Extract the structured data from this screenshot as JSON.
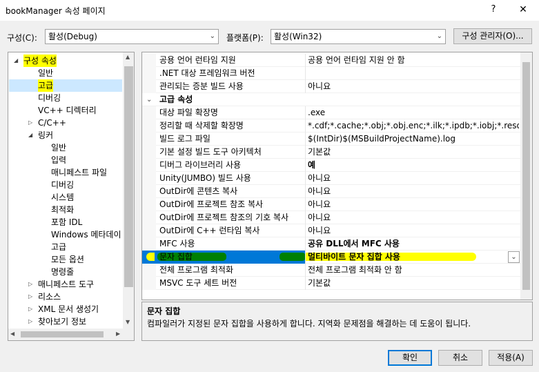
{
  "window": {
    "title": "bookManager 속성 페이지",
    "help": "?",
    "close": "✕"
  },
  "toolbar": {
    "config_label": "구성(C):",
    "config_value": "활성(Debug)",
    "platform_label": "플랫폼(P):",
    "platform_value": "활성(Win32)",
    "config_manager_label": "구성 관리자(O)..."
  },
  "tree": {
    "items": [
      {
        "label": "구성 속성",
        "level": 0,
        "arrow": "◢",
        "highlight": true
      },
      {
        "label": "일반",
        "level": 1
      },
      {
        "label": "고급",
        "level": 1,
        "selected": true,
        "highlight": true
      },
      {
        "label": "디버깅",
        "level": 1
      },
      {
        "label": "VC++ 디렉터리",
        "level": 1
      },
      {
        "label": "C/C++",
        "level": 1,
        "arrow": "▷"
      },
      {
        "label": "링커",
        "level": 1,
        "arrow": "◢"
      },
      {
        "label": "일반",
        "level": 2
      },
      {
        "label": "입력",
        "level": 2
      },
      {
        "label": "매니페스트 파일",
        "level": 2
      },
      {
        "label": "디버깅",
        "level": 2
      },
      {
        "label": "시스템",
        "level": 2
      },
      {
        "label": "최적화",
        "level": 2
      },
      {
        "label": "포함 IDL",
        "level": 2
      },
      {
        "label": "Windows 메타데이",
        "level": 2
      },
      {
        "label": "고급",
        "level": 2
      },
      {
        "label": "모든 옵션",
        "level": 2
      },
      {
        "label": "명령줄",
        "level": 2
      },
      {
        "label": "매니페스트 도구",
        "level": 1,
        "arrow": "▷"
      },
      {
        "label": "리소스",
        "level": 1,
        "arrow": "▷"
      },
      {
        "label": "XML 문서 생성기",
        "level": 1,
        "arrow": "▷"
      },
      {
        "label": "찾아보기 정보",
        "level": 1,
        "arrow": "▷"
      }
    ]
  },
  "grid": {
    "rows": [
      {
        "name": "공용 언어 런타임 지원",
        "value": "공용 언어 런타임 지원 안 함"
      },
      {
        "name": ".NET 대상 프레임워크 버전",
        "value": ""
      },
      {
        "name": "관리되는 증분 빌드 사용",
        "value": "아니요"
      },
      {
        "category": true,
        "name": "고급 속성",
        "arrow": "⌄"
      },
      {
        "name": "대상 파일 확장명",
        "value": ".exe"
      },
      {
        "name": "정리할 때 삭제할 확장명",
        "value": "*.cdf;*.cache;*.obj;*.obj.enc;*.ilk;*.ipdb;*.iobj;*.resources;*.t"
      },
      {
        "name": "빌드 로그 파일",
        "value": "$(IntDir)$(MSBuildProjectName).log"
      },
      {
        "name": "기본 설정 빌드 도구 아키텍처",
        "value": "기본값"
      },
      {
        "name": "디버그 라이브러리 사용",
        "value": "예",
        "bold": true
      },
      {
        "name": "Unity(JUMBO) 빌드 사용",
        "value": "아니요"
      },
      {
        "name": "OutDir에 콘텐츠 복사",
        "value": "아니요"
      },
      {
        "name": "OutDir에 프로젝트 참조 복사",
        "value": "아니요"
      },
      {
        "name": "OutDir에 프로젝트 참조의 기호 복사",
        "value": "아니요"
      },
      {
        "name": "OutDir에 C++ 런타임 복사",
        "value": "아니요"
      },
      {
        "name": "MFC 사용",
        "value": "공유 DLL에서 MFC 사용",
        "bold": true
      },
      {
        "name": "문자 집합",
        "value": "멀티바이트 문자 집합 사용",
        "bold": true,
        "selected": true,
        "highlight": true,
        "dropdown": "⌄"
      },
      {
        "name": "전체 프로그램 최적화",
        "value": "전체 프로그램 최적화 안 함"
      },
      {
        "name": "MSVC 도구 세트 버전",
        "value": "기본값"
      }
    ]
  },
  "description": {
    "title": "문자 집합",
    "text": "컴파일러가 지정된 문자 집합을 사용하게 합니다. 지역화 문제점을 해결하는 데 도움이 됩니다."
  },
  "buttons": {
    "ok": "확인",
    "cancel": "취소",
    "apply": "적용(A)"
  },
  "colors": {
    "selection_blue": "#0078d7",
    "highlighter_yellow": "#ffff00",
    "highlighter_green": "#008000",
    "tree_selection": "#cce8ff"
  }
}
